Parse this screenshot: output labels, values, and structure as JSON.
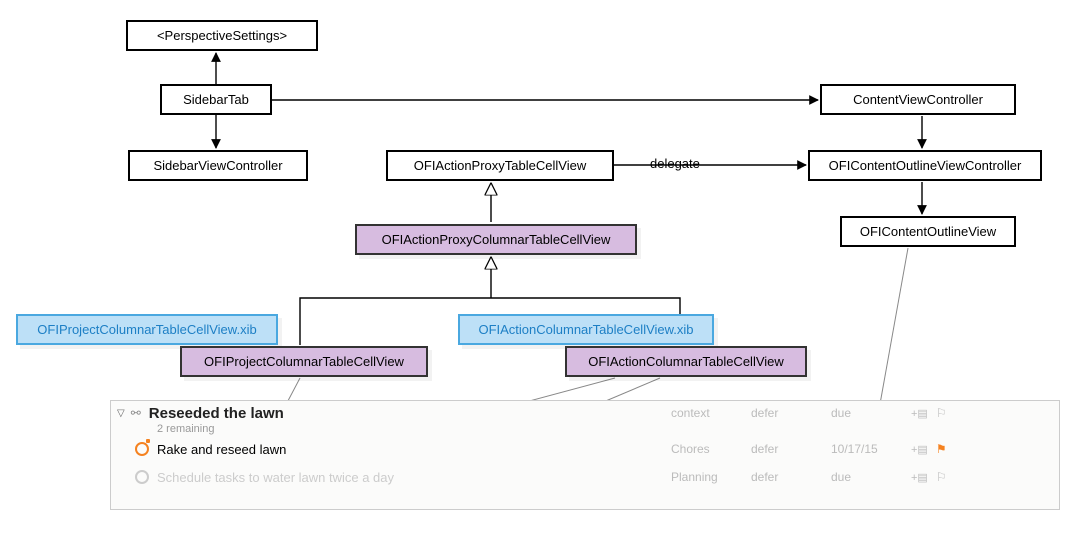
{
  "nodes": {
    "perspective": "<PerspectiveSettings>",
    "sidebarTab": "SidebarTab",
    "sidebarVC": "SidebarViewController",
    "contentVC": "ContentViewController",
    "ofiContentOutlineVC": "OFIContentOutlineViewController",
    "ofiContentOutlineView": "OFIContentOutlineView",
    "actionProxy": "OFIActionProxyTableCellView",
    "actionProxyColumnar": "OFIActionProxyColumnarTableCellView",
    "projectColumnar": "OFIProjectColumnarTableCellView",
    "projectColumnarXib": "OFIProjectColumnarTableCellView.xib",
    "actionColumnar": "OFIActionColumnarTableCellView",
    "actionColumnarXib": "OFIActionColumnarTableCellView.xib"
  },
  "edgeLabels": {
    "delegate": "delegate"
  },
  "outline": {
    "headers": {
      "context": "context",
      "defer": "defer",
      "due": "due"
    },
    "project": {
      "title": "Reseeded the lawn",
      "remaining": "2 remaining"
    },
    "rows": [
      {
        "title": "Rake and reseed lawn",
        "context": "Chores",
        "defer": "defer",
        "due": "10/17/15",
        "flagged": true,
        "status": "orange"
      },
      {
        "title": "Schedule tasks to water lawn twice a day",
        "context": "Planning",
        "defer": "defer",
        "due": "due",
        "flagged": false,
        "status": "faded"
      }
    ]
  }
}
